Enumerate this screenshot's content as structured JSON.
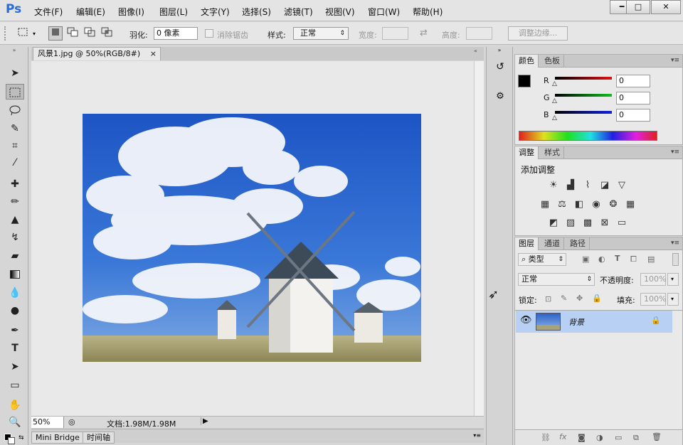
{
  "app": {
    "logo": "Ps"
  },
  "menu": [
    "文件(F)",
    "编辑(E)",
    "图像(I)",
    "图层(L)",
    "文字(Y)",
    "选择(S)",
    "滤镜(T)",
    "视图(V)",
    "窗口(W)",
    "帮助(H)"
  ],
  "window_controls": {
    "minimize": "━",
    "maximize": "□",
    "close": "✕"
  },
  "options": {
    "feather_label": "羽化:",
    "feather_value": "0 像素",
    "antialias_label": "消除锯齿",
    "style_label": "样式:",
    "style_value": "正常",
    "width_label": "宽度:",
    "height_label": "高度:",
    "refine_edge": "调整边缘..."
  },
  "document": {
    "tab_title": "风景1.jpg @ 50%(RGB/8#)",
    "tab_close": "×",
    "zoom": "50%",
    "doc_info": "文档:1.98M/1.98M"
  },
  "bottom_tabs": [
    "Mini Bridge",
    "时间轴"
  ],
  "color_panel": {
    "tabs": [
      "颜色",
      "色板"
    ],
    "channels": [
      {
        "label": "R",
        "value": "0",
        "color": "#d01010"
      },
      {
        "label": "G",
        "value": "0",
        "color": "#10b020"
      },
      {
        "label": "B",
        "value": "0",
        "color": "#1020d0"
      }
    ]
  },
  "adjust_panel": {
    "tabs": [
      "调整",
      "样式"
    ],
    "title": "添加调整",
    "icons_row1": [
      "brightness-icon",
      "levels-icon",
      "curves-icon",
      "exposure-icon",
      "vibrance-icon"
    ],
    "icons_row2": [
      "hue-saturation-icon",
      "color-balance-icon",
      "black-white-icon",
      "photo-filter-icon",
      "channel-mixer-icon",
      "color-lookup-icon"
    ],
    "icons_row3": [
      "invert-icon",
      "posterize-icon",
      "threshold-icon",
      "selective-color-icon",
      "gradient-map-icon"
    ]
  },
  "layers_panel": {
    "tabs": [
      "图层",
      "通道",
      "路径"
    ],
    "filter_label": "类型",
    "blend_mode": "正常",
    "opacity_label": "不透明度:",
    "opacity_value": "100%",
    "lock_label": "锁定:",
    "fill_label": "填充:",
    "fill_value": "100%",
    "layer_name": "背景"
  },
  "colors": {
    "accent": "#2b6cd4",
    "selected_layer": "#b8d0f4"
  }
}
